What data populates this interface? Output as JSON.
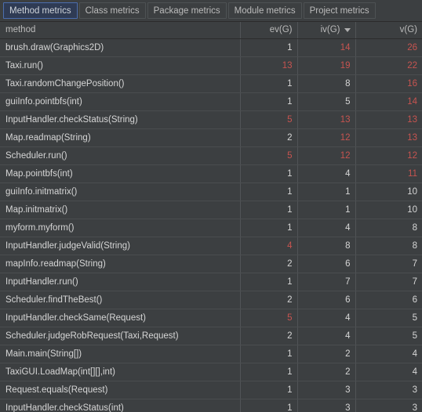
{
  "tabs": [
    {
      "label": "Method metrics",
      "selected": true
    },
    {
      "label": "Class metrics",
      "selected": false
    },
    {
      "label": "Package metrics",
      "selected": false
    },
    {
      "label": "Module metrics",
      "selected": false
    },
    {
      "label": "Project metrics",
      "selected": false
    }
  ],
  "table": {
    "columns": [
      {
        "key": "method",
        "label": "method",
        "align": "left",
        "sorted": false
      },
      {
        "key": "ev",
        "label": "ev(G)",
        "align": "right",
        "sorted": false
      },
      {
        "key": "iv",
        "label": "iv(G)",
        "align": "right",
        "sorted": true,
        "sort_direction": "desc",
        "sort_icon": "sort-descending-icon"
      },
      {
        "key": "v",
        "label": "v(G)",
        "align": "right",
        "sorted": false
      }
    ],
    "rows": [
      {
        "method": "brush.draw(Graphics2D)",
        "ev": "1",
        "iv": "14",
        "v": "26",
        "ev_warn": false,
        "iv_warn": true,
        "v_warn": true
      },
      {
        "method": "Taxi.run()",
        "ev": "13",
        "iv": "19",
        "v": "22",
        "ev_warn": true,
        "iv_warn": true,
        "v_warn": true
      },
      {
        "method": "Taxi.randomChangePosition()",
        "ev": "1",
        "iv": "8",
        "v": "16",
        "ev_warn": false,
        "iv_warn": false,
        "v_warn": true
      },
      {
        "method": "guiInfo.pointbfs(int)",
        "ev": "1",
        "iv": "5",
        "v": "14",
        "ev_warn": false,
        "iv_warn": false,
        "v_warn": true
      },
      {
        "method": "InputHandler.checkStatus(String)",
        "ev": "5",
        "iv": "13",
        "v": "13",
        "ev_warn": true,
        "iv_warn": true,
        "v_warn": true
      },
      {
        "method": "Map.readmap(String)",
        "ev": "2",
        "iv": "12",
        "v": "13",
        "ev_warn": false,
        "iv_warn": true,
        "v_warn": true
      },
      {
        "method": "Scheduler.run()",
        "ev": "5",
        "iv": "12",
        "v": "12",
        "ev_warn": true,
        "iv_warn": true,
        "v_warn": true
      },
      {
        "method": "Map.pointbfs(int)",
        "ev": "1",
        "iv": "4",
        "v": "11",
        "ev_warn": false,
        "iv_warn": false,
        "v_warn": true
      },
      {
        "method": "guiInfo.initmatrix()",
        "ev": "1",
        "iv": "1",
        "v": "10",
        "ev_warn": false,
        "iv_warn": false,
        "v_warn": false
      },
      {
        "method": "Map.initmatrix()",
        "ev": "1",
        "iv": "1",
        "v": "10",
        "ev_warn": false,
        "iv_warn": false,
        "v_warn": false
      },
      {
        "method": "myform.myform()",
        "ev": "1",
        "iv": "4",
        "v": "8",
        "ev_warn": false,
        "iv_warn": false,
        "v_warn": false
      },
      {
        "method": "InputHandler.judgeValid(String)",
        "ev": "4",
        "iv": "8",
        "v": "8",
        "ev_warn": true,
        "iv_warn": false,
        "v_warn": false
      },
      {
        "method": "mapInfo.readmap(String)",
        "ev": "2",
        "iv": "6",
        "v": "7",
        "ev_warn": false,
        "iv_warn": false,
        "v_warn": false
      },
      {
        "method": "InputHandler.run()",
        "ev": "1",
        "iv": "7",
        "v": "7",
        "ev_warn": false,
        "iv_warn": false,
        "v_warn": false
      },
      {
        "method": "Scheduler.findTheBest()",
        "ev": "2",
        "iv": "6",
        "v": "6",
        "ev_warn": false,
        "iv_warn": false,
        "v_warn": false
      },
      {
        "method": "InputHandler.checkSame(Request)",
        "ev": "5",
        "iv": "4",
        "v": "5",
        "ev_warn": true,
        "iv_warn": false,
        "v_warn": false
      },
      {
        "method": "Scheduler.judgeRobRequest(Taxi,Request)",
        "ev": "2",
        "iv": "4",
        "v": "5",
        "ev_warn": false,
        "iv_warn": false,
        "v_warn": false
      },
      {
        "method": "Main.main(String[])",
        "ev": "1",
        "iv": "2",
        "v": "4",
        "ev_warn": false,
        "iv_warn": false,
        "v_warn": false
      },
      {
        "method": "TaxiGUI.LoadMap(int[][],int)",
        "ev": "1",
        "iv": "2",
        "v": "4",
        "ev_warn": false,
        "iv_warn": false,
        "v_warn": false
      },
      {
        "method": "Request.equals(Request)",
        "ev": "1",
        "iv": "3",
        "v": "3",
        "ev_warn": false,
        "iv_warn": false,
        "v_warn": false
      },
      {
        "method": "InputHandler.checkStatus(int)",
        "ev": "1",
        "iv": "3",
        "v": "3",
        "ev_warn": false,
        "iv_warn": false,
        "v_warn": false
      }
    ]
  },
  "colors": {
    "background": "#3c3f41",
    "text": "#d6d6d6",
    "warning": "#c75450",
    "tab_selected_bg": "#2f3b54",
    "tab_selected_border": "#4b6eaf",
    "grid_line": "#4a4d4f"
  }
}
